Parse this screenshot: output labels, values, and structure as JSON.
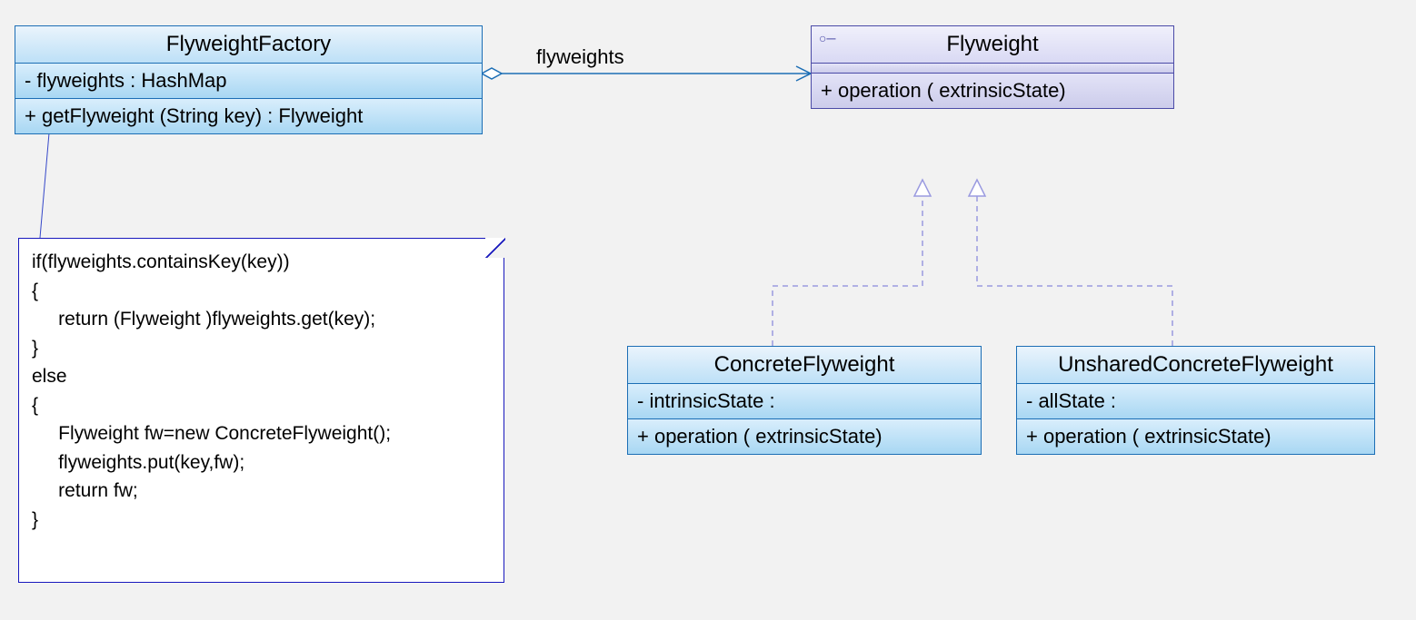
{
  "factory": {
    "title": "FlyweightFactory",
    "attr": "- flyweights  : HashMap",
    "op": "+  getFlyweight (String key)  : Flyweight"
  },
  "flyweight": {
    "title": "Flyweight",
    "op": "+  operation ( extrinsicState)"
  },
  "concrete": {
    "title": "ConcreteFlyweight",
    "attr": "-  intrinsicState  :",
    "op": "+  operation ( extrinsicState)"
  },
  "unshared": {
    "title": "UnsharedConcreteFlyweight",
    "attr": "-  allState  :",
    "op": "+  operation ( extrinsicState)"
  },
  "assoc_label": "flyweights",
  "note_text": "if(flyweights.containsKey(key))\n{\n     return (Flyweight )flyweights.get(key);\n}\nelse\n{\n     Flyweight fw=new ConcreteFlyweight();\n     flyweights.put(key,fw);\n     return fw;\n}"
}
